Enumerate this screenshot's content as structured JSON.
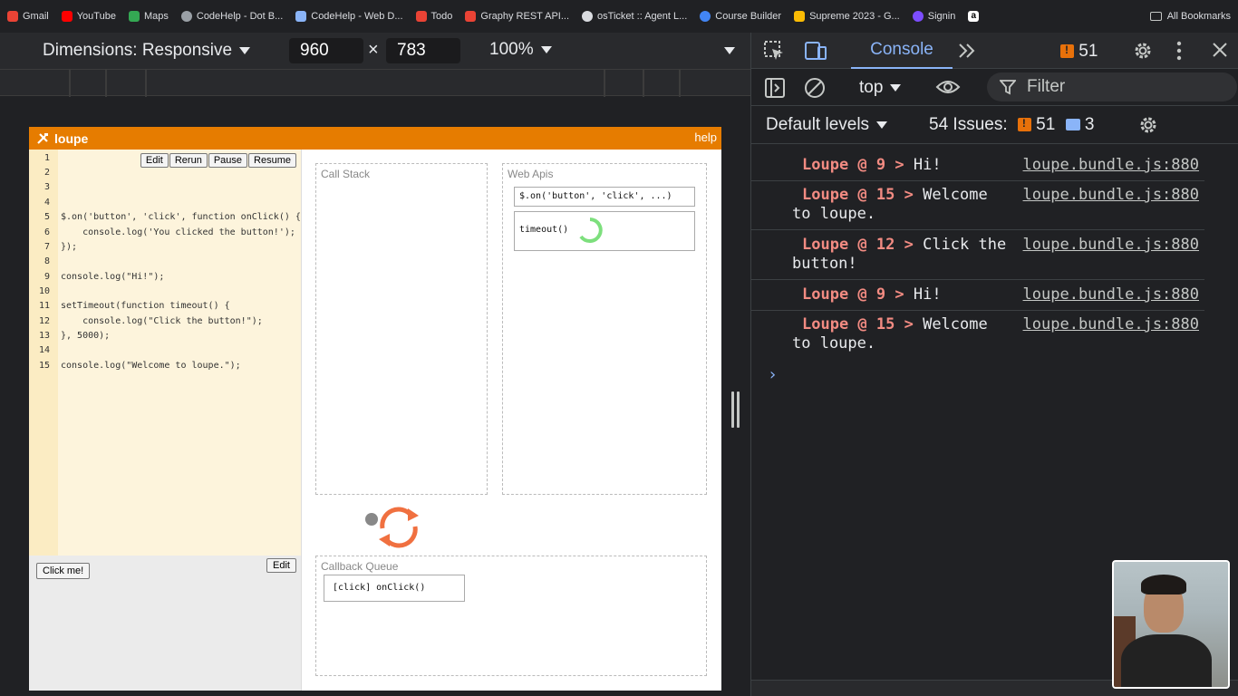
{
  "bookmarks": {
    "items": [
      {
        "label": "Gmail",
        "color": "#ea4335"
      },
      {
        "label": "YouTube",
        "color": "#ff0000"
      },
      {
        "label": "Maps",
        "color": "#34a853"
      },
      {
        "label": "CodeHelp - Dot B...",
        "color": "#9aa0a6"
      },
      {
        "label": "CodeHelp - Web D...",
        "color": "#8ab4f8"
      },
      {
        "label": "Todo",
        "color": "#ea4335"
      },
      {
        "label": "Graphy REST API...",
        "color": "#ea4335"
      },
      {
        "label": "osTicket :: Agent L...",
        "color": "#dadce0"
      },
      {
        "label": "Course Builder",
        "color": "#4285f4"
      },
      {
        "label": "Supreme 2023 - G...",
        "color": "#fbbc04"
      },
      {
        "label": "Signin",
        "color": "#7c4dff"
      },
      {
        "label": "",
        "color": "#ffffff"
      }
    ],
    "all_bookmarks": "All Bookmarks"
  },
  "device_toolbar": {
    "dimensions_label": "Dimensions: Responsive",
    "width": "960",
    "times": "×",
    "height": "783",
    "zoom": "100%"
  },
  "loupe": {
    "title": "loupe",
    "help": "help",
    "buttons": {
      "edit": "Edit",
      "rerun": "Rerun",
      "pause": "Pause",
      "resume": "Resume"
    },
    "code_lines": [
      {
        "n": "1",
        "code": ""
      },
      {
        "n": "2",
        "code": ""
      },
      {
        "n": "3",
        "code": ""
      },
      {
        "n": "4",
        "code": ""
      },
      {
        "n": "5",
        "code": "$.on('button', 'click', function onClick() {"
      },
      {
        "n": "6",
        "code": "    console.log('You clicked the button!');"
      },
      {
        "n": "7",
        "code": "});"
      },
      {
        "n": "8",
        "code": ""
      },
      {
        "n": "9",
        "code": "console.log(\"Hi!\");"
      },
      {
        "n": "10",
        "code": ""
      },
      {
        "n": "11",
        "code": "setTimeout(function timeout() {"
      },
      {
        "n": "12",
        "code": "    console.log(\"Click the button!\");"
      },
      {
        "n": "13",
        "code": "}, 5000);"
      },
      {
        "n": "14",
        "code": ""
      },
      {
        "n": "15",
        "code": "console.log(\"Welcome to loupe.\");"
      }
    ],
    "click_me": "Click me!",
    "edit2": "Edit",
    "call_stack": "Call Stack",
    "web_apis": "Web Apis",
    "web_api_items": [
      "$.on('button', 'click', ...)",
      "timeout()"
    ],
    "callback_queue": "Callback Queue",
    "queue_items": [
      "[click] onClick()"
    ]
  },
  "devtools": {
    "tab_console": "Console",
    "error_count": "51",
    "context": "top",
    "filter_placeholder": "Filter",
    "default_levels": "Default levels",
    "issues_label": "54 Issues:",
    "issues_errors": "51",
    "issues_info": "3",
    "logs": [
      {
        "who": "Loupe @ 9 >",
        "msg": "Hi!",
        "src": "loupe.bundle.js:880"
      },
      {
        "who": "Loupe @ 15 >",
        "msg": "Welcome to loupe.",
        "src": "loupe.bundle.js:880"
      },
      {
        "who": "Loupe @ 12 >",
        "msg": "Click the button!",
        "src": "loupe.bundle.js:880"
      },
      {
        "who": "Loupe @ 9 >",
        "msg": "Hi!",
        "src": "loupe.bundle.js:880"
      },
      {
        "who": "Loupe @ 15 >",
        "msg": "Welcome to loupe.",
        "src": "loupe.bundle.js:880"
      }
    ],
    "prompt": "›"
  },
  "colors": {
    "accent": "#8ab4f8",
    "loupe_header": "#e67c00",
    "log_source": "#f28b82"
  }
}
